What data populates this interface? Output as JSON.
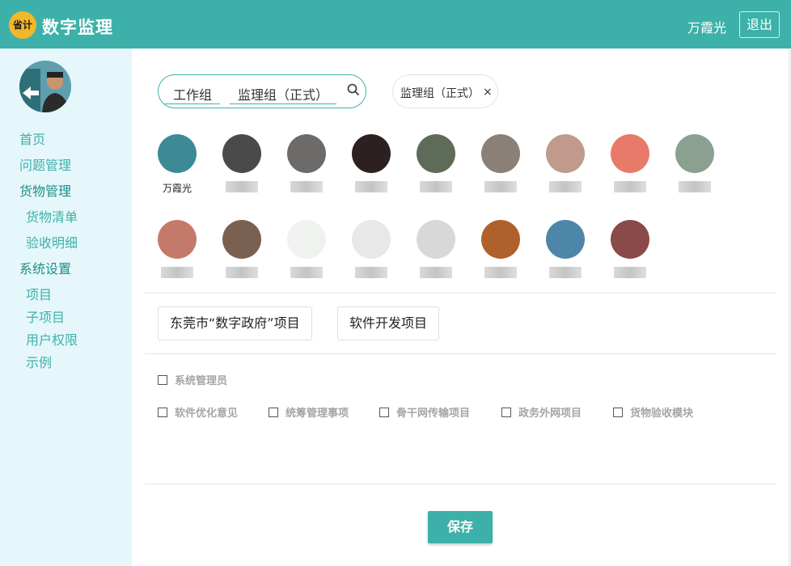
{
  "header": {
    "logo_text": "省计",
    "app_title": "数字监理",
    "user_name": "万霞光",
    "logout_label": "退出",
    "color": "#3db1a9"
  },
  "sidebar": {
    "avatar_icon": "user-avatar-photo",
    "items": [
      {
        "label": "首页"
      },
      {
        "label": "问题管理"
      },
      {
        "label": "货物管理"
      },
      {
        "label": "货物清单"
      },
      {
        "label": "验收明细"
      },
      {
        "label": "系统设置"
      },
      {
        "label": "项目"
      },
      {
        "label": "子项目"
      },
      {
        "label": "用户权限"
      },
      {
        "label": "示例"
      }
    ]
  },
  "search": {
    "tags": [
      "工作组",
      "监理组（正式）"
    ],
    "icon": "search-icon"
  },
  "selected_group": {
    "label": "监理组（正式）",
    "close": "×"
  },
  "members": [
    {
      "name": "万霞光",
      "color": "#3c8a96"
    },
    {
      "name": "",
      "color": "#4a4a4a"
    },
    {
      "name": "",
      "color": "#6d6a6a"
    },
    {
      "name": "",
      "color": "#2c2020"
    },
    {
      "name": "",
      "color": "#5d6b58"
    },
    {
      "name": "",
      "color": "#8a8078"
    },
    {
      "name": "",
      "color": "#c09a8c"
    },
    {
      "name": "",
      "color": "#e87a6a"
    },
    {
      "name": "",
      "color": "#8aa090"
    },
    {
      "name": "",
      "color": "#c47a6a"
    },
    {
      "name": "",
      "color": "#7a6050"
    },
    {
      "name": "",
      "color": "#f0f2ef"
    },
    {
      "name": "",
      "color": "#e8e8e8"
    },
    {
      "name": "",
      "color": "#d8d8d8"
    },
    {
      "name": "",
      "color": "#b0602a"
    },
    {
      "name": "",
      "color": "#4d86a8"
    },
    {
      "name": "",
      "color": "#8a4a4a"
    }
  ],
  "projects": [
    {
      "label": "东莞市“数字政府”项目"
    },
    {
      "label": "软件开发项目"
    }
  ],
  "permissions": [
    {
      "label": "系统管理员",
      "checked": false
    },
    {
      "label": "软件优化意见",
      "checked": false
    },
    {
      "label": "统筹管理事项",
      "checked": false
    },
    {
      "label": "骨干网传输项目",
      "checked": false
    },
    {
      "label": "政务外网项目",
      "checked": false
    },
    {
      "label": "货物验收模块",
      "checked": false
    }
  ],
  "save_label": "保存"
}
